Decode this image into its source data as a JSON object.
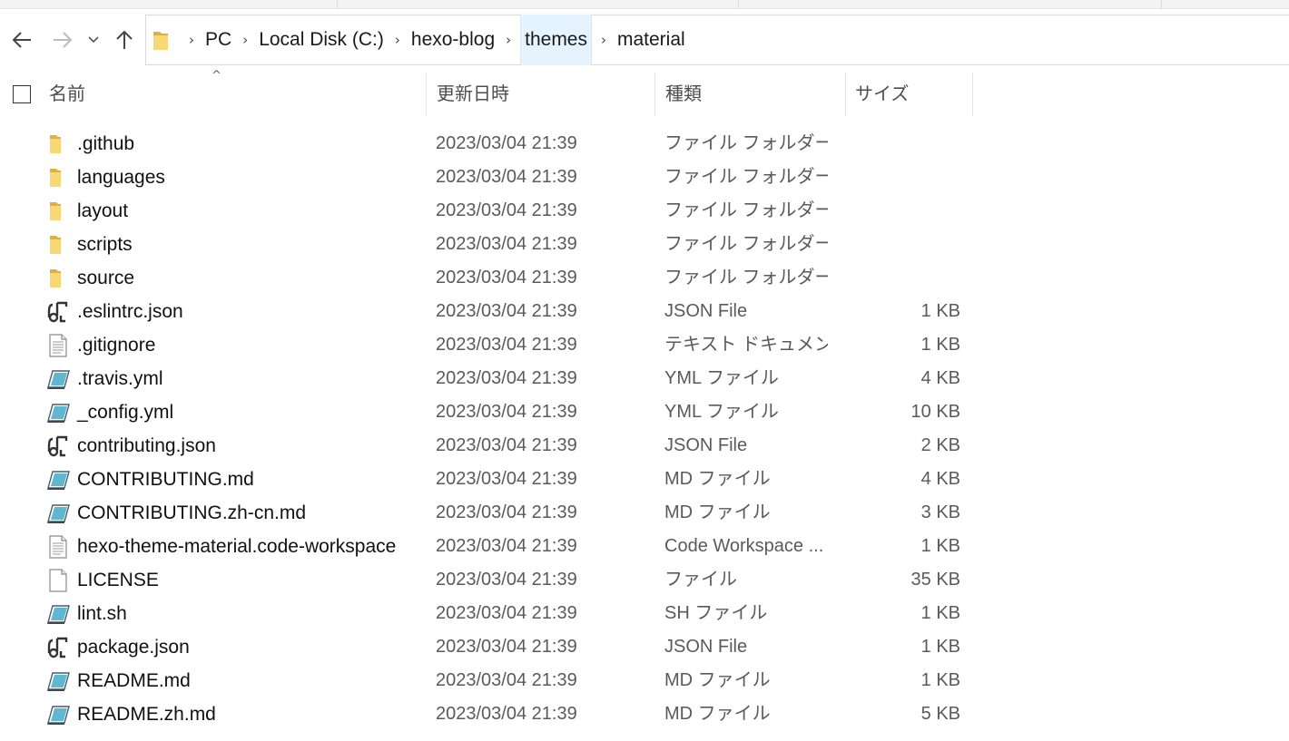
{
  "colors": {
    "folder": "#f8d775",
    "folder_dark": "#e0b03f",
    "crumb_highlight": "#e5f3ff",
    "text": "#1a1a1a",
    "muted": "#5a5a5a"
  },
  "address_bar": {
    "breadcrumbs": [
      {
        "label": "PC"
      },
      {
        "label": "Local Disk (C:)"
      },
      {
        "label": "hexo-blog"
      },
      {
        "label": "themes"
      },
      {
        "label": "material"
      }
    ]
  },
  "columns": {
    "name": "名前",
    "date": "更新日時",
    "type": "種類",
    "size": "サイズ"
  },
  "files": [
    {
      "name": ".github",
      "date": "2023/03/04 21:39",
      "type": "ファイル フォルダー",
      "size": "",
      "icon": "folder-icon"
    },
    {
      "name": "languages",
      "date": "2023/03/04 21:39",
      "type": "ファイル フォルダー",
      "size": "",
      "icon": "folder-icon"
    },
    {
      "name": "layout",
      "date": "2023/03/04 21:39",
      "type": "ファイル フォルダー",
      "size": "",
      "icon": "folder-icon"
    },
    {
      "name": "scripts",
      "date": "2023/03/04 21:39",
      "type": "ファイル フォルダー",
      "size": "",
      "icon": "folder-icon"
    },
    {
      "name": "source",
      "date": "2023/03/04 21:39",
      "type": "ファイル フォルダー",
      "size": "",
      "icon": "folder-icon"
    },
    {
      "name": ".eslintrc.json",
      "date": "2023/03/04 21:39",
      "type": "JSON File",
      "size": "1 KB",
      "icon": "json-file-icon"
    },
    {
      "name": ".gitignore",
      "date": "2023/03/04 21:39",
      "type": "テキスト ドキュメント",
      "size": "1 KB",
      "icon": "text-file-icon"
    },
    {
      "name": ".travis.yml",
      "date": "2023/03/04 21:39",
      "type": "YML ファイル",
      "size": "4 KB",
      "icon": "editor-file-icon"
    },
    {
      "name": "_config.yml",
      "date": "2023/03/04 21:39",
      "type": "YML ファイル",
      "size": "10 KB",
      "icon": "editor-file-icon"
    },
    {
      "name": "contributing.json",
      "date": "2023/03/04 21:39",
      "type": "JSON File",
      "size": "2 KB",
      "icon": "json-file-icon"
    },
    {
      "name": "CONTRIBUTING.md",
      "date": "2023/03/04 21:39",
      "type": "MD ファイル",
      "size": "4 KB",
      "icon": "editor-file-icon"
    },
    {
      "name": "CONTRIBUTING.zh-cn.md",
      "date": "2023/03/04 21:39",
      "type": "MD ファイル",
      "size": "3 KB",
      "icon": "editor-file-icon"
    },
    {
      "name": "hexo-theme-material.code-workspace",
      "date": "2023/03/04 21:39",
      "type": "Code Workspace ...",
      "size": "1 KB",
      "icon": "text-file-icon"
    },
    {
      "name": "LICENSE",
      "date": "2023/03/04 21:39",
      "type": "ファイル",
      "size": "35 KB",
      "icon": "blank-file-icon"
    },
    {
      "name": "lint.sh",
      "date": "2023/03/04 21:39",
      "type": "SH ファイル",
      "size": "1 KB",
      "icon": "editor-file-icon"
    },
    {
      "name": "package.json",
      "date": "2023/03/04 21:39",
      "type": "JSON File",
      "size": "1 KB",
      "icon": "json-file-icon"
    },
    {
      "name": "README.md",
      "date": "2023/03/04 21:39",
      "type": "MD ファイル",
      "size": "1 KB",
      "icon": "editor-file-icon"
    },
    {
      "name": "README.zh.md",
      "date": "2023/03/04 21:39",
      "type": "MD ファイル",
      "size": "5 KB",
      "icon": "editor-file-icon"
    }
  ]
}
